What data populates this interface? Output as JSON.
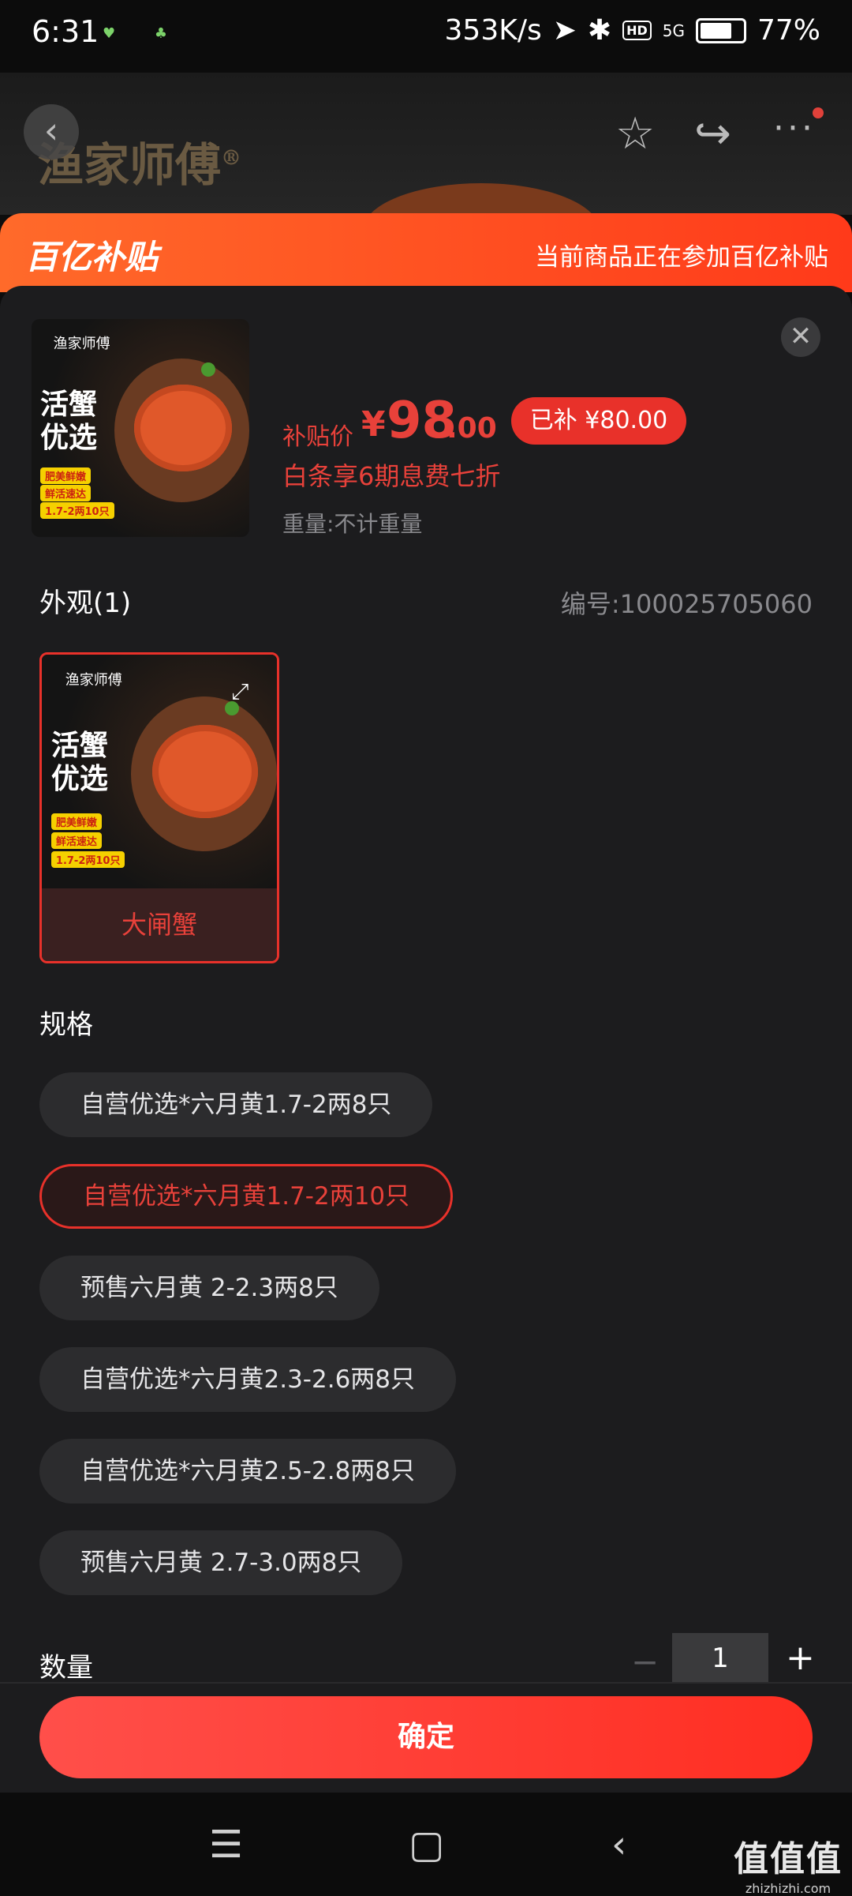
{
  "status_bar": {
    "time": "6:31",
    "net_speed": "353K/s",
    "signal": "5G",
    "hd": "HD",
    "battery": "77%",
    "battery_level": 0.77
  },
  "background_page": {
    "brand": "渔家师傅",
    "brand_mark": "®"
  },
  "banner": {
    "logo": "百亿补贴",
    "notice": "当前商品正在参加百亿补贴"
  },
  "product": {
    "thumb": {
      "brand": "渔家师傅",
      "title": "活蟹优选",
      "tags": [
        "肥美鲜嫩",
        "鲜活速达",
        "1.7-2两10只"
      ]
    },
    "price_label": "补贴价",
    "currency": "¥",
    "price_int": "98",
    "price_dec": ".00",
    "subsidy": "已补 ¥80.00",
    "installment": "白条享6期息费七折",
    "weight": "重量:不计重量"
  },
  "appearance": {
    "title": "外观(1)",
    "sku": "编号:100025705060",
    "variants": [
      {
        "label": "大闸蟹",
        "selected": true
      }
    ]
  },
  "spec": {
    "title": "规格",
    "options": [
      {
        "label": "自营优选*六月黄1.7-2两8只",
        "selected": false
      },
      {
        "label": "自营优选*六月黄1.7-2两10只",
        "selected": true
      },
      {
        "label": "预售六月黄 2-2.3两8只",
        "selected": false
      },
      {
        "label": "自营优选*六月黄2.3-2.6两8只",
        "selected": false
      },
      {
        "label": "自营优选*六月黄2.5-2.8两8只",
        "selected": false
      },
      {
        "label": "预售六月黄 2.7-3.0两8只",
        "selected": false
      }
    ]
  },
  "quantity": {
    "title": "数量",
    "value": "1",
    "minus": "−",
    "plus": "+"
  },
  "confirm_label": "确定",
  "navbar": {
    "menu": "☰",
    "home": "▢",
    "back": "‹"
  },
  "watermark": {
    "brand": "值值值",
    "site": "zhizhizhi.com"
  }
}
